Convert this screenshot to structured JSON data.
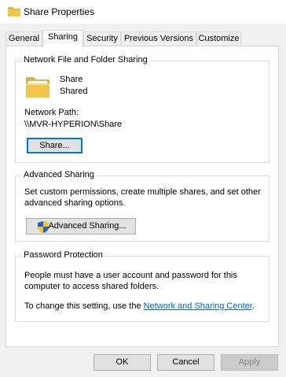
{
  "window": {
    "title": "Share Properties"
  },
  "tabs": [
    {
      "label": "General"
    },
    {
      "label": "Sharing"
    },
    {
      "label": "Security"
    },
    {
      "label": "Previous Versions"
    },
    {
      "label": "Customize"
    }
  ],
  "active_tab": "Sharing",
  "network_sharing": {
    "title": "Network File and Folder Sharing",
    "folder_name": "Share",
    "status": "Shared",
    "network_path_label": "Network Path:",
    "network_path_value": "\\\\MVR-HYPERION\\Share",
    "share_button": "Share..."
  },
  "advanced_sharing": {
    "title": "Advanced Sharing",
    "description_line1": "Set custom permissions, create multiple shares, and set other",
    "description_line2": "advanced sharing options.",
    "button": "Advanced Sharing..."
  },
  "password_protection": {
    "title": "Password Protection",
    "line1": "People must have a user account and password for this",
    "line2": "computer to access shared folders.",
    "change_prefix": "To change this setting, use the ",
    "link_text": "Network and Sharing Center",
    "change_suffix": "."
  },
  "footer": {
    "ok": "OK",
    "cancel": "Cancel",
    "apply": "Apply"
  },
  "colors": {
    "accent": "#0078d7",
    "link": "#0066cc",
    "folder": "#f2c54c"
  },
  "icons": {
    "title": "folder-icon",
    "network_folder": "folder-icon",
    "advanced_button": "shield-icon"
  }
}
